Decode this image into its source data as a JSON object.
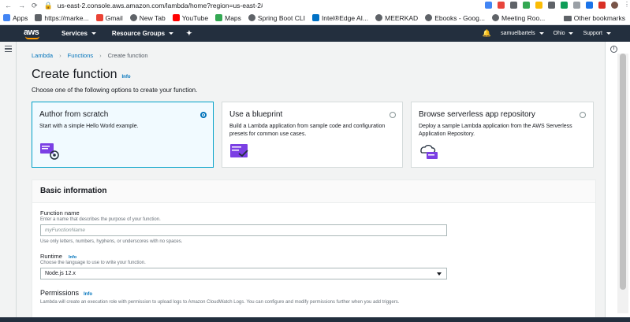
{
  "browser": {
    "url": "us-east-2.console.aws.amazon.com/lambda/home?region=us-east-2#/create/function",
    "bookmarks": [
      {
        "label": "Apps",
        "color": "#4285f4"
      },
      {
        "label": "https://marke...",
        "color": "#5f6368"
      },
      {
        "label": "Gmail",
        "color": "#ea4335"
      },
      {
        "label": "New Tab",
        "color": "#5f6368"
      },
      {
        "label": "YouTube",
        "color": "#ff0000"
      },
      {
        "label": "Maps",
        "color": "#34a853"
      },
      {
        "label": "Spring Boot CLI",
        "color": "#5f6368"
      },
      {
        "label": "Intel®Edge AI...",
        "color": "#0071c5"
      },
      {
        "label": "MEERKAD",
        "color": "#5f6368"
      },
      {
        "label": "Ebooks - Goog...",
        "color": "#5f6368"
      },
      {
        "label": "Meeting Roo...",
        "color": "#5f6368"
      }
    ],
    "other_bookmarks": "Other bookmarks"
  },
  "awsnav": {
    "logo": "aws",
    "services": "Services",
    "resource_groups": "Resource Groups",
    "user": "samuelbartels",
    "region": "Ohio",
    "support": "Support"
  },
  "breadcrumbs": [
    "Lambda",
    "Functions",
    "Create function"
  ],
  "page": {
    "title": "Create function",
    "info": "Info",
    "subtitle": "Choose one of the following options to create your function."
  },
  "options": [
    {
      "title": "Author from scratch",
      "desc": "Start with a simple Hello World example.",
      "selected": true
    },
    {
      "title": "Use a blueprint",
      "desc": "Build a Lambda application from sample code and configuration presets for common use cases.",
      "selected": false
    },
    {
      "title": "Browse serverless app repository",
      "desc": "Deploy a sample Lambda application from the AWS Serverless Application Repository.",
      "selected": false
    }
  ],
  "basic": {
    "heading": "Basic information",
    "fn_label": "Function name",
    "fn_hint": "Enter a name that describes the purpose of your function.",
    "fn_placeholder": "myFunctionName",
    "fn_rules": "Use only letters, numbers, hyphens, or underscores with no spaces.",
    "runtime_label": "Runtime",
    "runtime_info": "Info",
    "runtime_hint": "Choose the language to use to write your function.",
    "runtime_value": "Node.js 12.x",
    "perm_label": "Permissions",
    "perm_info": "Info",
    "perm_hint": "Lambda will create an execution role with permission to upload logs to Amazon CloudWatch Logs. You can configure and modify permissions further when you add triggers."
  },
  "colors": {
    "accent": "#0073bb",
    "nav": "#232f3e",
    "orange": "#ff9900",
    "selected_bg": "#f1faff"
  }
}
